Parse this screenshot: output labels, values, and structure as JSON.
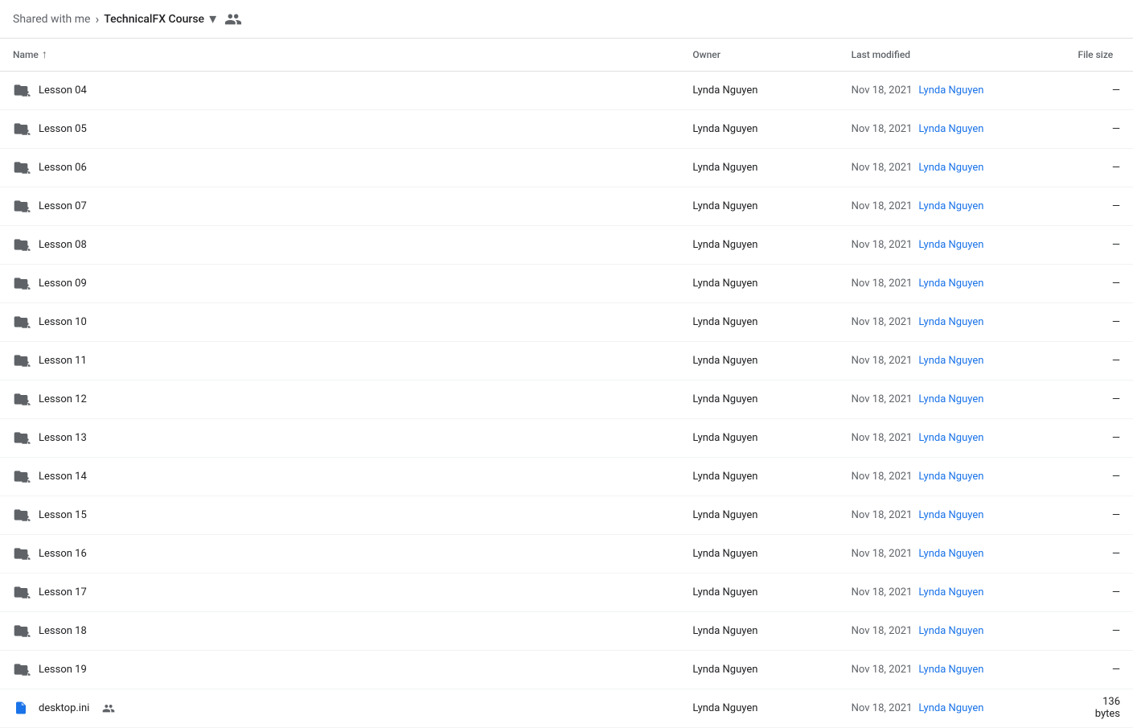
{
  "breadcrumb": {
    "parent_label": "Shared with me",
    "separator": "›",
    "current_folder": "TechnicalFX Course",
    "dropdown_icon": "▾"
  },
  "table": {
    "columns": {
      "name": "Name",
      "sort_indicator": "↑",
      "owner": "Owner",
      "last_modified": "Last modified",
      "file_size": "File size"
    },
    "rows": [
      {
        "id": 1,
        "type": "folder-shared",
        "name": "Lesson 04",
        "owner": "Lynda Nguyen",
        "modified_date": "Nov 18, 2021",
        "modified_by": "Lynda Nguyen",
        "size": "—"
      },
      {
        "id": 2,
        "type": "folder-shared",
        "name": "Lesson 05",
        "owner": "Lynda Nguyen",
        "modified_date": "Nov 18, 2021",
        "modified_by": "Lynda Nguyen",
        "size": "—"
      },
      {
        "id": 3,
        "type": "folder-shared",
        "name": "Lesson 06",
        "owner": "Lynda Nguyen",
        "modified_date": "Nov 18, 2021",
        "modified_by": "Lynda Nguyen",
        "size": "—"
      },
      {
        "id": 4,
        "type": "folder-shared",
        "name": "Lesson 07",
        "owner": "Lynda Nguyen",
        "modified_date": "Nov 18, 2021",
        "modified_by": "Lynda Nguyen",
        "size": "—"
      },
      {
        "id": 5,
        "type": "folder-shared",
        "name": "Lesson 08",
        "owner": "Lynda Nguyen",
        "modified_date": "Nov 18, 2021",
        "modified_by": "Lynda Nguyen",
        "size": "—"
      },
      {
        "id": 6,
        "type": "folder-shared",
        "name": "Lesson 09",
        "owner": "Lynda Nguyen",
        "modified_date": "Nov 18, 2021",
        "modified_by": "Lynda Nguyen",
        "size": "—"
      },
      {
        "id": 7,
        "type": "folder-shared",
        "name": "Lesson 10",
        "owner": "Lynda Nguyen",
        "modified_date": "Nov 18, 2021",
        "modified_by": "Lynda Nguyen",
        "size": "—"
      },
      {
        "id": 8,
        "type": "folder-shared",
        "name": "Lesson 11",
        "owner": "Lynda Nguyen",
        "modified_date": "Nov 18, 2021",
        "modified_by": "Lynda Nguyen",
        "size": "—"
      },
      {
        "id": 9,
        "type": "folder-shared",
        "name": "Lesson 12",
        "owner": "Lynda Nguyen",
        "modified_date": "Nov 18, 2021",
        "modified_by": "Lynda Nguyen",
        "size": "—"
      },
      {
        "id": 10,
        "type": "folder-shared",
        "name": "Lesson 13",
        "owner": "Lynda Nguyen",
        "modified_date": "Nov 18, 2021",
        "modified_by": "Lynda Nguyen",
        "size": "—"
      },
      {
        "id": 11,
        "type": "folder-shared",
        "name": "Lesson 14",
        "owner": "Lynda Nguyen",
        "modified_date": "Nov 18, 2021",
        "modified_by": "Lynda Nguyen",
        "size": "—"
      },
      {
        "id": 12,
        "type": "folder-shared",
        "name": "Lesson 15",
        "owner": "Lynda Nguyen",
        "modified_date": "Nov 18, 2021",
        "modified_by": "Lynda Nguyen",
        "size": "—"
      },
      {
        "id": 13,
        "type": "folder-shared",
        "name": "Lesson 16",
        "owner": "Lynda Nguyen",
        "modified_date": "Nov 18, 2021",
        "modified_by": "Lynda Nguyen",
        "size": "—"
      },
      {
        "id": 14,
        "type": "folder-shared",
        "name": "Lesson 17",
        "owner": "Lynda Nguyen",
        "modified_date": "Nov 18, 2021",
        "modified_by": "Lynda Nguyen",
        "size": "—"
      },
      {
        "id": 15,
        "type": "folder-shared",
        "name": "Lesson 18",
        "owner": "Lynda Nguyen",
        "modified_date": "Nov 18, 2021",
        "modified_by": "Lynda Nguyen",
        "size": "—"
      },
      {
        "id": 16,
        "type": "folder-shared",
        "name": "Lesson 19",
        "owner": "Lynda Nguyen",
        "modified_date": "Nov 18, 2021",
        "modified_by": "Lynda Nguyen",
        "size": "—"
      },
      {
        "id": 17,
        "type": "file-shared",
        "name": "desktop.ini",
        "owner": "Lynda Nguyen",
        "modified_date": "Nov 18, 2021",
        "modified_by": "Lynda Nguyen",
        "size": "136 bytes"
      }
    ]
  },
  "colors": {
    "folder": "#5f6368",
    "folder_dark": "#3c4043",
    "file_blue": "#1a73e8",
    "link_blue": "#1a73e8",
    "text_secondary": "#5f6368",
    "divider": "#e0e0e0"
  }
}
